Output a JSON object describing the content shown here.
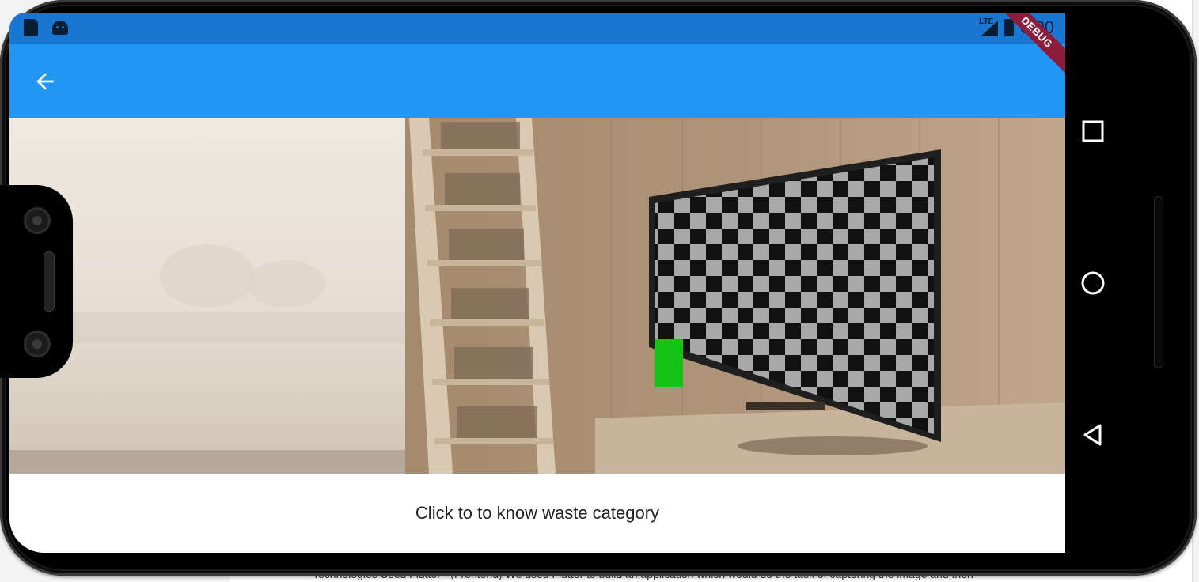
{
  "status_bar": {
    "network": "LTE",
    "time": "0:00",
    "icons": [
      "sd-card-icon",
      "android-icon",
      "lte-signal-icon",
      "battery-charging-icon"
    ]
  },
  "app_bar": {
    "back_icon": "arrow-back-icon",
    "color": "#2196f3",
    "status_color": "#1976d2"
  },
  "debug_banner": {
    "label": "DEBUG",
    "color": "#8b1d3c"
  },
  "main": {
    "image_description": "living room photo with TV showing checkerboard",
    "category_button_label": "Click to to know waste category"
  },
  "navigation_bar": {
    "icons": [
      "recents-square-icon",
      "home-circle-icon",
      "back-triangle-icon"
    ]
  },
  "background_page": {
    "text": "Technologies Used Flutter - (Frontend) We used Flutter to build an application which would do the task of capturing the image and then"
  }
}
